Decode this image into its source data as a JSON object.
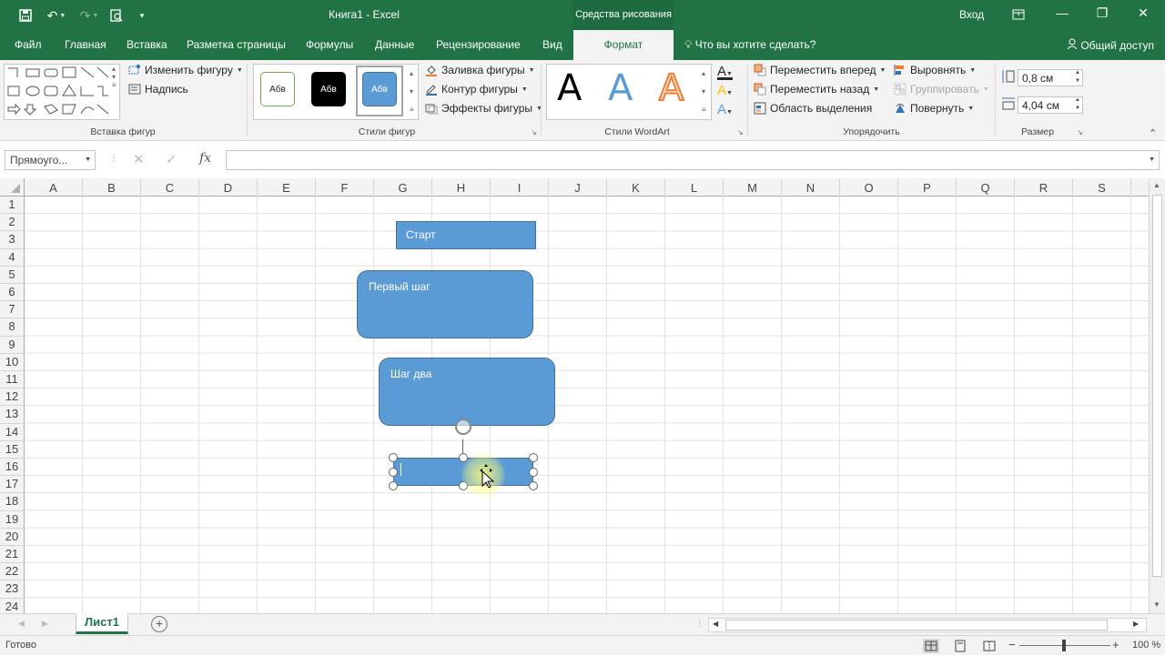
{
  "title_bar": {
    "doc_title": "Книга1  -  Excel",
    "context_tools": "Средства рисования",
    "sign_in": "Вход"
  },
  "tabs": [
    "Файл",
    "Главная",
    "Вставка",
    "Разметка страницы",
    "Формулы",
    "Данные",
    "Рецензирование",
    "Вид"
  ],
  "active_tab": "Формат",
  "tell_me": "Что вы хотите сделать?",
  "share": "Общий доступ",
  "ribbon": {
    "insert_shapes": {
      "edit_shape": "Изменить фигуру",
      "text_box": "Надпись",
      "label": "Вставка фигур"
    },
    "shape_styles": {
      "sample_text": "Абв",
      "fill": "Заливка фигуры",
      "outline": "Контур фигуры",
      "effects": "Эффекты фигуры",
      "label": "Стили фигур"
    },
    "wordart": {
      "sample": "A",
      "label": "Стили WordArt"
    },
    "arrange": {
      "bring_forward": "Переместить вперед",
      "send_backward": "Переместить назад",
      "selection_pane": "Область выделения",
      "align": "Выровнять",
      "group": "Группировать",
      "rotate": "Повернуть",
      "label": "Упорядочить"
    },
    "size": {
      "height": "0,8 см",
      "width": "4,04 см",
      "label": "Размер"
    }
  },
  "formula_bar": {
    "name_box": "Прямоуго...",
    "fx": "fx",
    "formula": ""
  },
  "columns": [
    "A",
    "B",
    "C",
    "D",
    "E",
    "F",
    "G",
    "H",
    "I",
    "J",
    "K",
    "L",
    "M",
    "N",
    "O",
    "P",
    "Q",
    "R",
    "S"
  ],
  "rows": [
    "1",
    "2",
    "3",
    "4",
    "5",
    "6",
    "7",
    "8",
    "9",
    "10",
    "11",
    "12",
    "13",
    "14",
    "15",
    "16",
    "17",
    "18",
    "19",
    "20",
    "21",
    "22",
    "23",
    "24"
  ],
  "shapes": {
    "start": "Старт",
    "step_one": "Первый шаг",
    "step_two": "Шаг два",
    "selected": ""
  },
  "sheet_tab": "Лист1",
  "status": {
    "ready": "Готово",
    "zoom": "100 %"
  },
  "colors": {
    "accent": "#217346",
    "shape_fill": "#5b9bd5",
    "shape_border": "#41719c"
  }
}
